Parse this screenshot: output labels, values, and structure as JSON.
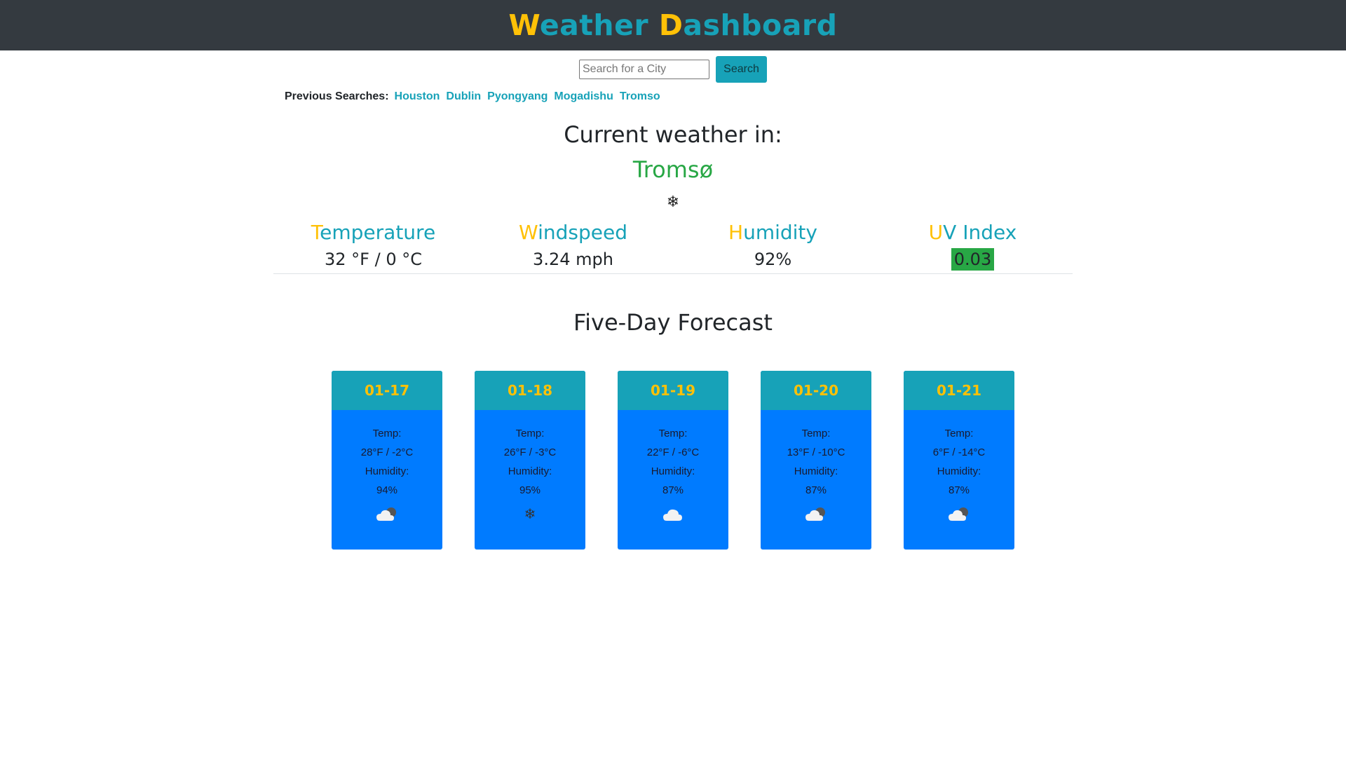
{
  "header": {
    "title_w": "W",
    "title_eather": "eather ",
    "title_d": "D",
    "title_ashboard": "ashboard"
  },
  "search": {
    "placeholder": "Search for a City",
    "button_label": "Search"
  },
  "previous": {
    "label": "Previous Searches:",
    "cities": [
      "Houston",
      "Dublin",
      "Pyongyang",
      "Mogadishu",
      "Tromso"
    ]
  },
  "current": {
    "title": "Current weather in:",
    "city": "Tromsø",
    "icon": "snowflake-icon",
    "stats": [
      {
        "first": "T",
        "rest": "emperature",
        "value": "32 °F / 0 °C"
      },
      {
        "first": "W",
        "rest": "indspeed",
        "value": "3.24 mph"
      },
      {
        "first": "H",
        "rest": "umidity",
        "value": "92%"
      },
      {
        "first": "U",
        "rest": "V Index",
        "value": "0.03"
      }
    ]
  },
  "forecast": {
    "title": "Five-Day Forecast",
    "temp_label": "Temp:",
    "humidity_label": "Humidity:",
    "days": [
      {
        "date": "01-17",
        "temp": "28°F / -2°C",
        "humidity": "94%",
        "icon": "partly-cloudy-icon"
      },
      {
        "date": "01-18",
        "temp": "26°F / -3°C",
        "humidity": "95%",
        "icon": "snowflake-icon"
      },
      {
        "date": "01-19",
        "temp": "22°F / -6°C",
        "humidity": "87%",
        "icon": "cloud-icon"
      },
      {
        "date": "01-20",
        "temp": "13°F / -10°C",
        "humidity": "87%",
        "icon": "partly-cloudy-icon"
      },
      {
        "date": "01-21",
        "temp": "6°F / -14°C",
        "humidity": "87%",
        "icon": "partly-cloudy-icon"
      }
    ]
  },
  "colors": {
    "header_bg": "#343a40",
    "accent_teal": "#17a2b8",
    "accent_yellow": "#ffc107",
    "city_green": "#28a745",
    "card_blue": "#007bff",
    "uv_badge": "#28a745"
  }
}
